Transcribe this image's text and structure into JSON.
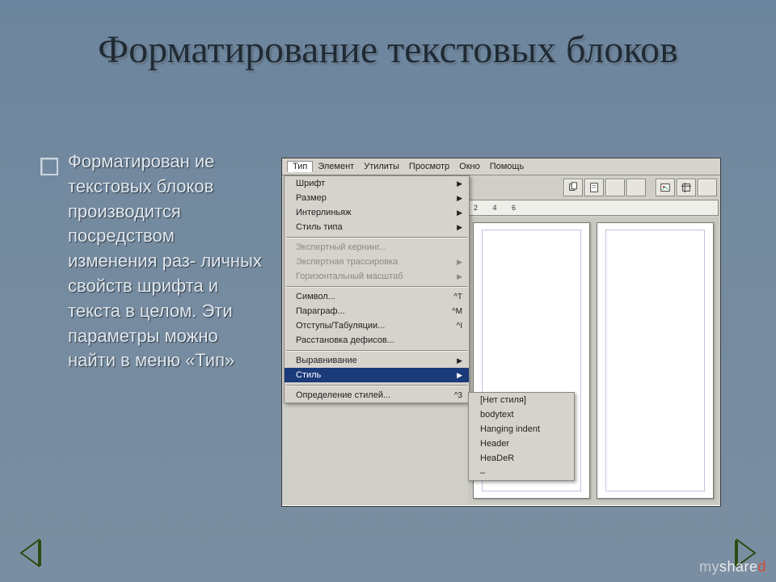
{
  "slide": {
    "title": "Форматирование текстовых блоков",
    "bullet_text": "Форматирован ие текстовых блоков производится посредством изменения раз- личных свойств шрифта и текста в целом. Эти параметры можно найти в меню «Тип»"
  },
  "menubar": {
    "items": [
      {
        "label": "Тип",
        "active": true
      },
      {
        "label": "Элемент",
        "active": false
      },
      {
        "label": "Утилиты",
        "active": false
      },
      {
        "label": "Просмотр",
        "active": false
      },
      {
        "label": "Окно",
        "active": false
      },
      {
        "label": "Помощь",
        "active": false
      }
    ]
  },
  "ruler_text": "2 4 6",
  "dropdown": {
    "groups": [
      [
        {
          "label": "Шрифт",
          "submenu": true,
          "disabled": false,
          "highlighted": false
        },
        {
          "label": "Размер",
          "submenu": true,
          "disabled": false,
          "highlighted": false
        },
        {
          "label": "Интерлиньяж",
          "submenu": true,
          "disabled": false,
          "highlighted": false
        },
        {
          "label": "Стиль типа",
          "submenu": true,
          "disabled": false,
          "highlighted": false
        }
      ],
      [
        {
          "label": "Экспертный кернинг...",
          "submenu": false,
          "disabled": true,
          "highlighted": false
        },
        {
          "label": "Экспертная трассировка",
          "submenu": true,
          "disabled": true,
          "highlighted": false
        },
        {
          "label": "Горизонтальный масштаб",
          "submenu": true,
          "disabled": true,
          "highlighted": false
        }
      ],
      [
        {
          "label": "Символ...",
          "submenu": false,
          "shortcut": "^T",
          "disabled": false,
          "highlighted": false
        },
        {
          "label": "Параграф...",
          "submenu": false,
          "shortcut": "^M",
          "disabled": false,
          "highlighted": false
        },
        {
          "label": "Отступы/Табуляции...",
          "submenu": false,
          "shortcut": "^I",
          "disabled": false,
          "highlighted": false
        },
        {
          "label": "Расстановка дефисов...",
          "submenu": false,
          "disabled": false,
          "highlighted": false
        }
      ],
      [
        {
          "label": "Выравнивание",
          "submenu": true,
          "disabled": false,
          "highlighted": false
        },
        {
          "label": "Стиль",
          "submenu": true,
          "disabled": false,
          "highlighted": true
        }
      ],
      [
        {
          "label": "Определение стилей...",
          "submenu": false,
          "shortcut": "^3",
          "disabled": false,
          "highlighted": false
        }
      ]
    ]
  },
  "submenu": {
    "items": [
      {
        "label": "[Нет стиля]"
      },
      {
        "label": "bodytext"
      },
      {
        "label": "Hanging indent"
      },
      {
        "label": "Header"
      },
      {
        "label": "HeaDeR"
      },
      {
        "label": "–"
      }
    ]
  },
  "watermark": {
    "my": "my",
    "share": "share",
    "red": "d"
  },
  "nav": {
    "prev": "prev-slide",
    "next": "next-slide"
  }
}
